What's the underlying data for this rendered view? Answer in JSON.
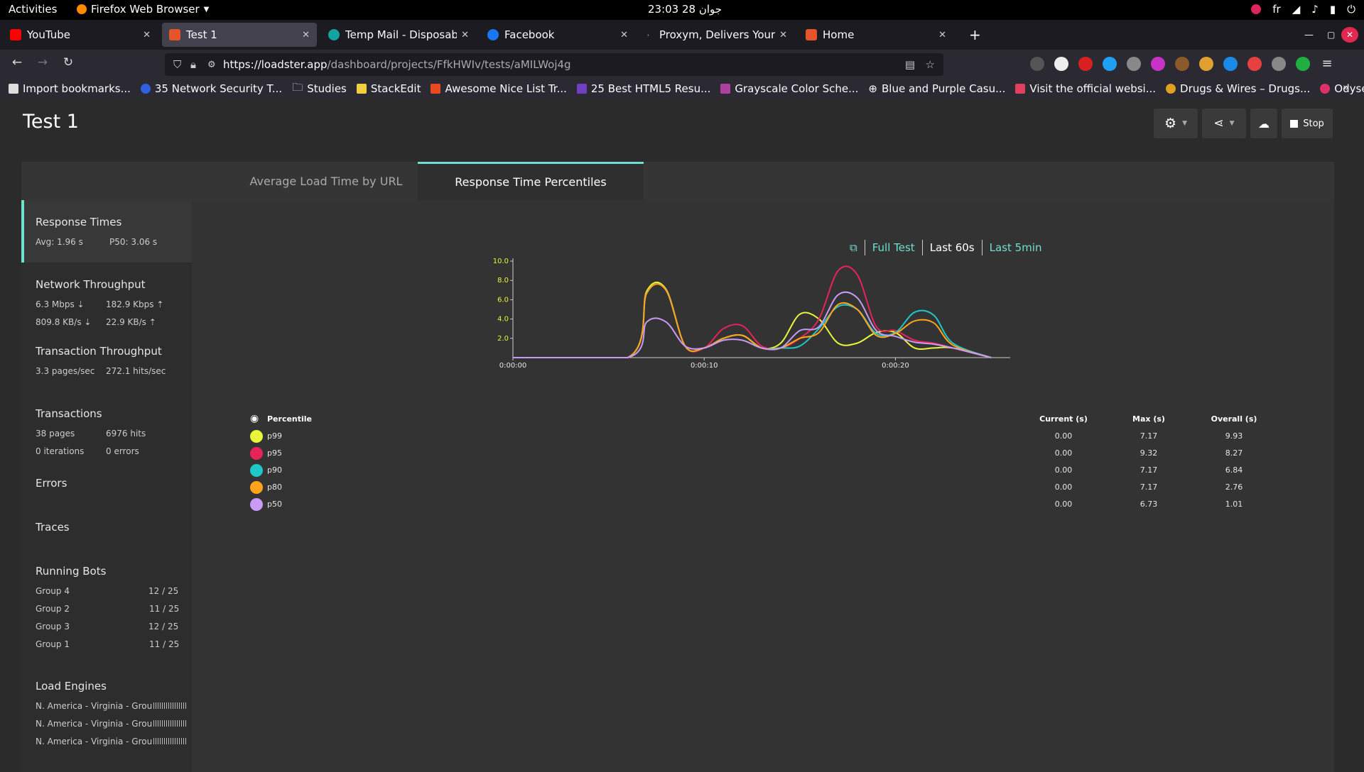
{
  "os": {
    "activities": "Activities",
    "app_menu": "Firefox Web Browser",
    "clock": "23:03  28 جوان",
    "lang": "fr"
  },
  "tabs": [
    {
      "title": "YouTube",
      "color": "#ff0000"
    },
    {
      "title": "Test 1",
      "color": "#e8542a"
    },
    {
      "title": "Temp Mail - Disposable T",
      "color": "#14a3a0"
    },
    {
      "title": "Facebook",
      "color": "#1877f2"
    },
    {
      "title": "Proxym, Delivers Your Di",
      "color": "#666666"
    },
    {
      "title": "Home",
      "color": "#e8542a"
    }
  ],
  "nav": {
    "url_host": "https://loadster.app",
    "url_path": "/dashboard/projects/FfkHWIv/tests/aMILWoj4g"
  },
  "bookmarks": [
    "Import bookmarks...",
    "35 Network Security T...",
    "Studies",
    "StackEdit",
    "Awesome Nice List Tr...",
    "25 Best HTML5 Resu...",
    "Grayscale Color Sche...",
    "Blue and Purple Casu...",
    "Visit the official websi...",
    "Drugs & Wires – Drugs...",
    "Odysee"
  ],
  "page": {
    "title": "Test 1",
    "stop_label": "Stop",
    "tabs": [
      "Average Load Time by URL",
      "Response Time Percentiles"
    ]
  },
  "sidebar": {
    "response_times": {
      "title": "Response Times",
      "avg": "Avg: 1.96 s",
      "p50": "P50: 3.06 s"
    },
    "network": {
      "title": "Network Throughput",
      "down_bits": "6.3 Mbps ⇣",
      "up_bits": "182.9 Kbps ⇡",
      "down_bytes": "809.8 KB/s ⇣",
      "up_bytes": "22.9 KB/s ⇡"
    },
    "transaction": {
      "title": "Transaction Throughput",
      "pages": "3.3 pages/sec",
      "hits": "272.1 hits/sec"
    },
    "transactions": {
      "title": "Transactions",
      "pages": "38 pages",
      "hits": "6976 hits",
      "iterations": "0 iterations",
      "errors": "0 errors"
    },
    "errors": "Errors",
    "traces": "Traces",
    "bots": {
      "title": "Running Bots",
      "groups": [
        {
          "name": "Group 4",
          "count": "12 / 25"
        },
        {
          "name": "Group 2",
          "count": "11 / 25"
        },
        {
          "name": "Group 3",
          "count": "12 / 25"
        },
        {
          "name": "Group 1",
          "count": "11 / 25"
        }
      ]
    },
    "engines": {
      "title": "Load Engines",
      "items": [
        "N. America - Virginia - Grou",
        "N. America - Virginia - Grou",
        "N. America - Virginia - Grou"
      ]
    }
  },
  "range": {
    "full": "Full Test",
    "last60": "Last 60s",
    "last5": "Last 5min"
  },
  "chart_data": {
    "type": "line",
    "x_ticks": [
      "0:00:00",
      "0:00:10",
      "0:00:20"
    ],
    "y_ticks": [
      "2.0",
      "4.0",
      "6.0",
      "8.0",
      "10.0"
    ],
    "ylim": [
      0,
      10
    ],
    "xlim": [
      0,
      26
    ],
    "series": [
      {
        "name": "p99",
        "color": "#e8f53a",
        "points": [
          [
            0,
            0
          ],
          [
            6,
            0
          ],
          [
            7,
            6.9
          ],
          [
            8,
            7.1
          ],
          [
            9,
            1.2
          ],
          [
            10,
            1
          ],
          [
            11,
            2
          ],
          [
            12,
            2.3
          ],
          [
            13,
            1
          ],
          [
            14,
            1.5
          ],
          [
            15,
            4.5
          ],
          [
            16,
            4
          ],
          [
            17,
            1.5
          ],
          [
            18,
            1.5
          ],
          [
            19,
            2.6
          ],
          [
            20,
            2.6
          ],
          [
            21,
            1
          ],
          [
            22,
            1
          ],
          [
            23,
            1
          ],
          [
            25,
            0
          ]
        ]
      },
      {
        "name": "p95",
        "color": "#e8235a",
        "points": [
          [
            0,
            0
          ],
          [
            6,
            0
          ],
          [
            7,
            6.7
          ],
          [
            8,
            7
          ],
          [
            9,
            1.2
          ],
          [
            10,
            1
          ],
          [
            11,
            3
          ],
          [
            12,
            3.3
          ],
          [
            13,
            1.2
          ],
          [
            14,
            1
          ],
          [
            15,
            2
          ],
          [
            16,
            4
          ],
          [
            17,
            9
          ],
          [
            18,
            8.6
          ],
          [
            19,
            3.2
          ],
          [
            20,
            2.8
          ],
          [
            21,
            1.8
          ],
          [
            22,
            1.5
          ],
          [
            23,
            1
          ],
          [
            25,
            0
          ]
        ]
      },
      {
        "name": "p90",
        "color": "#1ec8c8",
        "points": [
          [
            0,
            0
          ],
          [
            6,
            0
          ],
          [
            7,
            6.7
          ],
          [
            8,
            7
          ],
          [
            9,
            1.2
          ],
          [
            10,
            1
          ],
          [
            11,
            2
          ],
          [
            12,
            2.3
          ],
          [
            13,
            1
          ],
          [
            14,
            1
          ],
          [
            15,
            1.2
          ],
          [
            16,
            3
          ],
          [
            17,
            5.3
          ],
          [
            18,
            5
          ],
          [
            19,
            2.5
          ],
          [
            20,
            2.6
          ],
          [
            21,
            4.7
          ],
          [
            22,
            4.4
          ],
          [
            23,
            1.5
          ],
          [
            25,
            0
          ]
        ]
      },
      {
        "name": "p80",
        "color": "#ffa41b",
        "points": [
          [
            0,
            0
          ],
          [
            6,
            0
          ],
          [
            7,
            6.7
          ],
          [
            8,
            7
          ],
          [
            9,
            1.2
          ],
          [
            10,
            1
          ],
          [
            11,
            2
          ],
          [
            12,
            2.3
          ],
          [
            13,
            1
          ],
          [
            14,
            1
          ],
          [
            15,
            2
          ],
          [
            16,
            2.6
          ],
          [
            17,
            5.5
          ],
          [
            18,
            5
          ],
          [
            19,
            2.3
          ],
          [
            20,
            2.5
          ],
          [
            21,
            3.8
          ],
          [
            22,
            3.6
          ],
          [
            23,
            1.3
          ],
          [
            25,
            0
          ]
        ]
      },
      {
        "name": "p50",
        "color": "#c89bf5",
        "points": [
          [
            0,
            0
          ],
          [
            6,
            0
          ],
          [
            7,
            3.7
          ],
          [
            8,
            3.7
          ],
          [
            9,
            1.2
          ],
          [
            10,
            1
          ],
          [
            11,
            1.8
          ],
          [
            12,
            1.8
          ],
          [
            13,
            1
          ],
          [
            14,
            1
          ],
          [
            15,
            2.8
          ],
          [
            16,
            3.2
          ],
          [
            17,
            6.5
          ],
          [
            18,
            6.2
          ],
          [
            19,
            2.8
          ],
          [
            20,
            2.2
          ],
          [
            21,
            1.6
          ],
          [
            22,
            1.4
          ],
          [
            23,
            1
          ],
          [
            25,
            0
          ]
        ]
      }
    ]
  },
  "legend": {
    "header": {
      "percentile": "Percentile",
      "current": "Current (s)",
      "max": "Max (s)",
      "overall": "Overall (s)"
    },
    "rows": [
      {
        "name": "p99",
        "color": "#e8f53a",
        "current": "0.00",
        "max": "7.17",
        "overall": "9.93"
      },
      {
        "name": "p95",
        "color": "#e8235a",
        "current": "0.00",
        "max": "9.32",
        "overall": "8.27"
      },
      {
        "name": "p90",
        "color": "#1ec8c8",
        "current": "0.00",
        "max": "7.17",
        "overall": "6.84"
      },
      {
        "name": "p80",
        "color": "#ffa41b",
        "current": "0.00",
        "max": "7.17",
        "overall": "2.76"
      },
      {
        "name": "p50",
        "color": "#c89bf5",
        "current": "0.00",
        "max": "6.73",
        "overall": "1.01"
      }
    ]
  }
}
